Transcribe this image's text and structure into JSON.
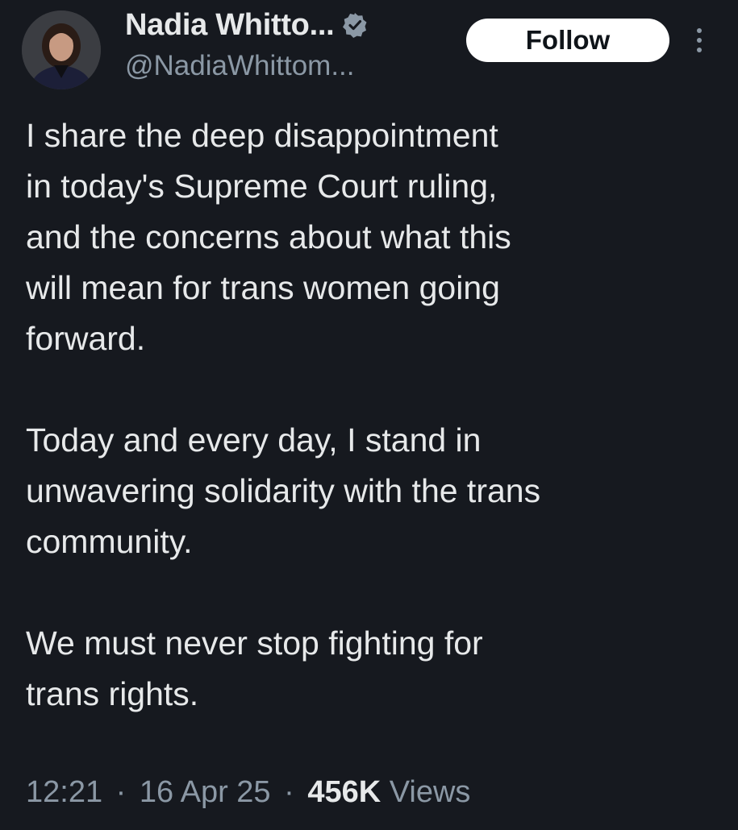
{
  "author": {
    "display_name": "Nadia Whitto...",
    "handle": "@NadiaWhittom...",
    "avatar_icon": "profile-photo-icon",
    "verified_icon": "verified-badge-icon"
  },
  "actions": {
    "follow_label": "Follow",
    "more_icon": "more-vertical-icon"
  },
  "tweet": {
    "lines_p1": [
      "I share the deep disappointment",
      "in today's Supreme Court ruling,",
      "and the concerns about what this",
      "will mean for trans women going",
      "forward."
    ],
    "lines_p2": [
      "Today and every day, I stand in",
      "unwavering solidarity with the trans",
      "community."
    ],
    "lines_p3": [
      "We must never stop fighting for",
      "trans rights."
    ]
  },
  "meta": {
    "time": "12:21",
    "date": "16 Apr 25",
    "views_count": "456K",
    "views_label": "Views",
    "separator": "·"
  },
  "colors": {
    "background": "#16191f",
    "text_primary": "#e7e9ea",
    "text_secondary": "#8b98a5",
    "follow_bg": "#ffffff",
    "follow_text": "#0f1419"
  }
}
